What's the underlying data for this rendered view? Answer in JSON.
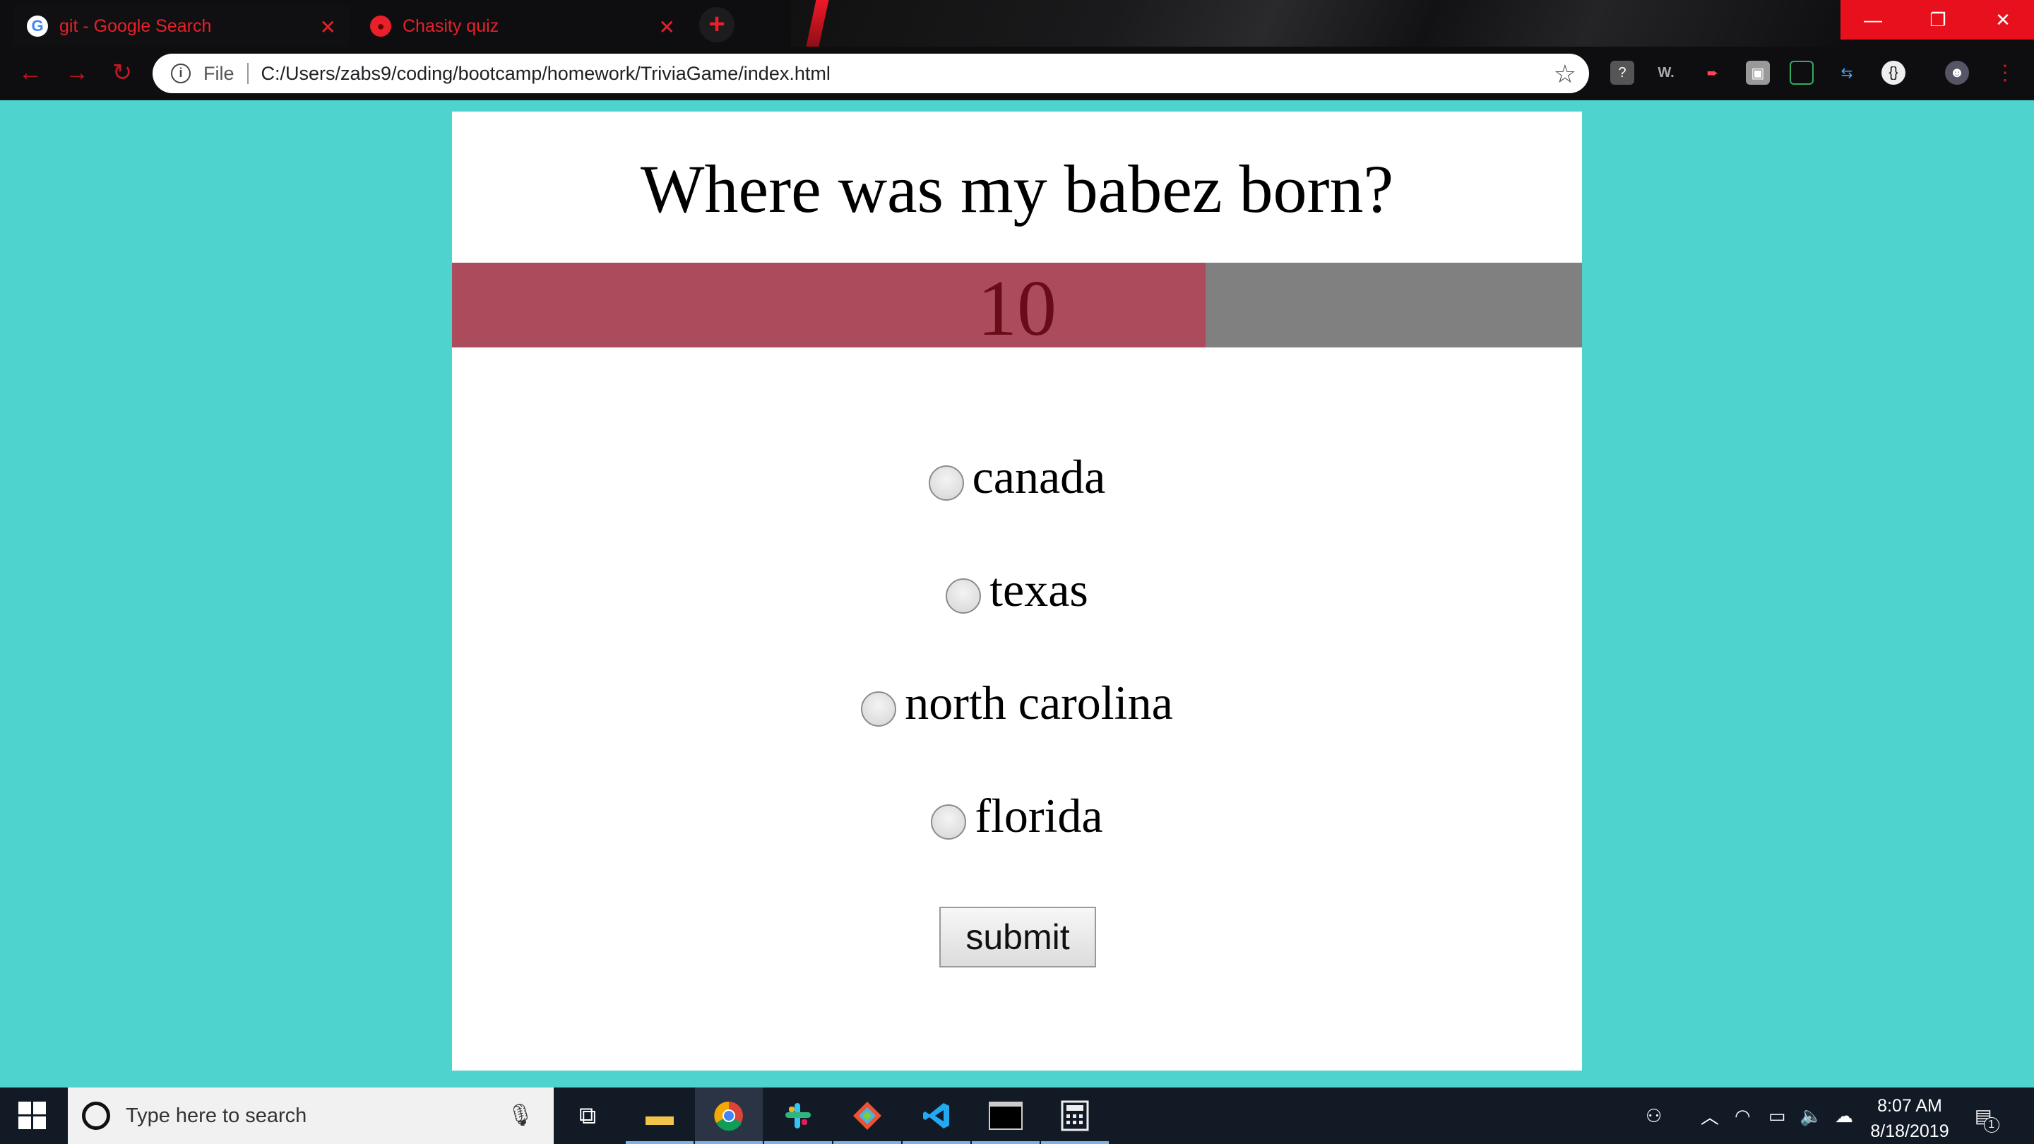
{
  "browser": {
    "tabs": [
      {
        "title": "git - Google Search",
        "favicon": "google-g-icon",
        "active": true
      },
      {
        "title": "Chasity quiz",
        "favicon": "globe-icon",
        "active": false
      }
    ],
    "address": {
      "scheme_label": "File",
      "url": "C:/Users/zabs9/coding/bootcamp/homework/TriviaGame/index.html"
    },
    "extensions_text": {
      "word": "W."
    },
    "accent_color": "#e8202a"
  },
  "quiz": {
    "question": "Where was my babez born?",
    "timer": {
      "value": "10",
      "fill_fraction": 0.667,
      "fill_color": "#ab4b5b",
      "track_color": "#808080"
    },
    "choices": [
      "canada",
      "texas",
      "north carolina",
      "florida"
    ],
    "submit_label": "submit",
    "background_color": "#4ed3cf"
  },
  "taskbar": {
    "search_placeholder": "Type here to search",
    "time": "8:07 AM",
    "date": "8/18/2019",
    "notification_count": "1"
  }
}
